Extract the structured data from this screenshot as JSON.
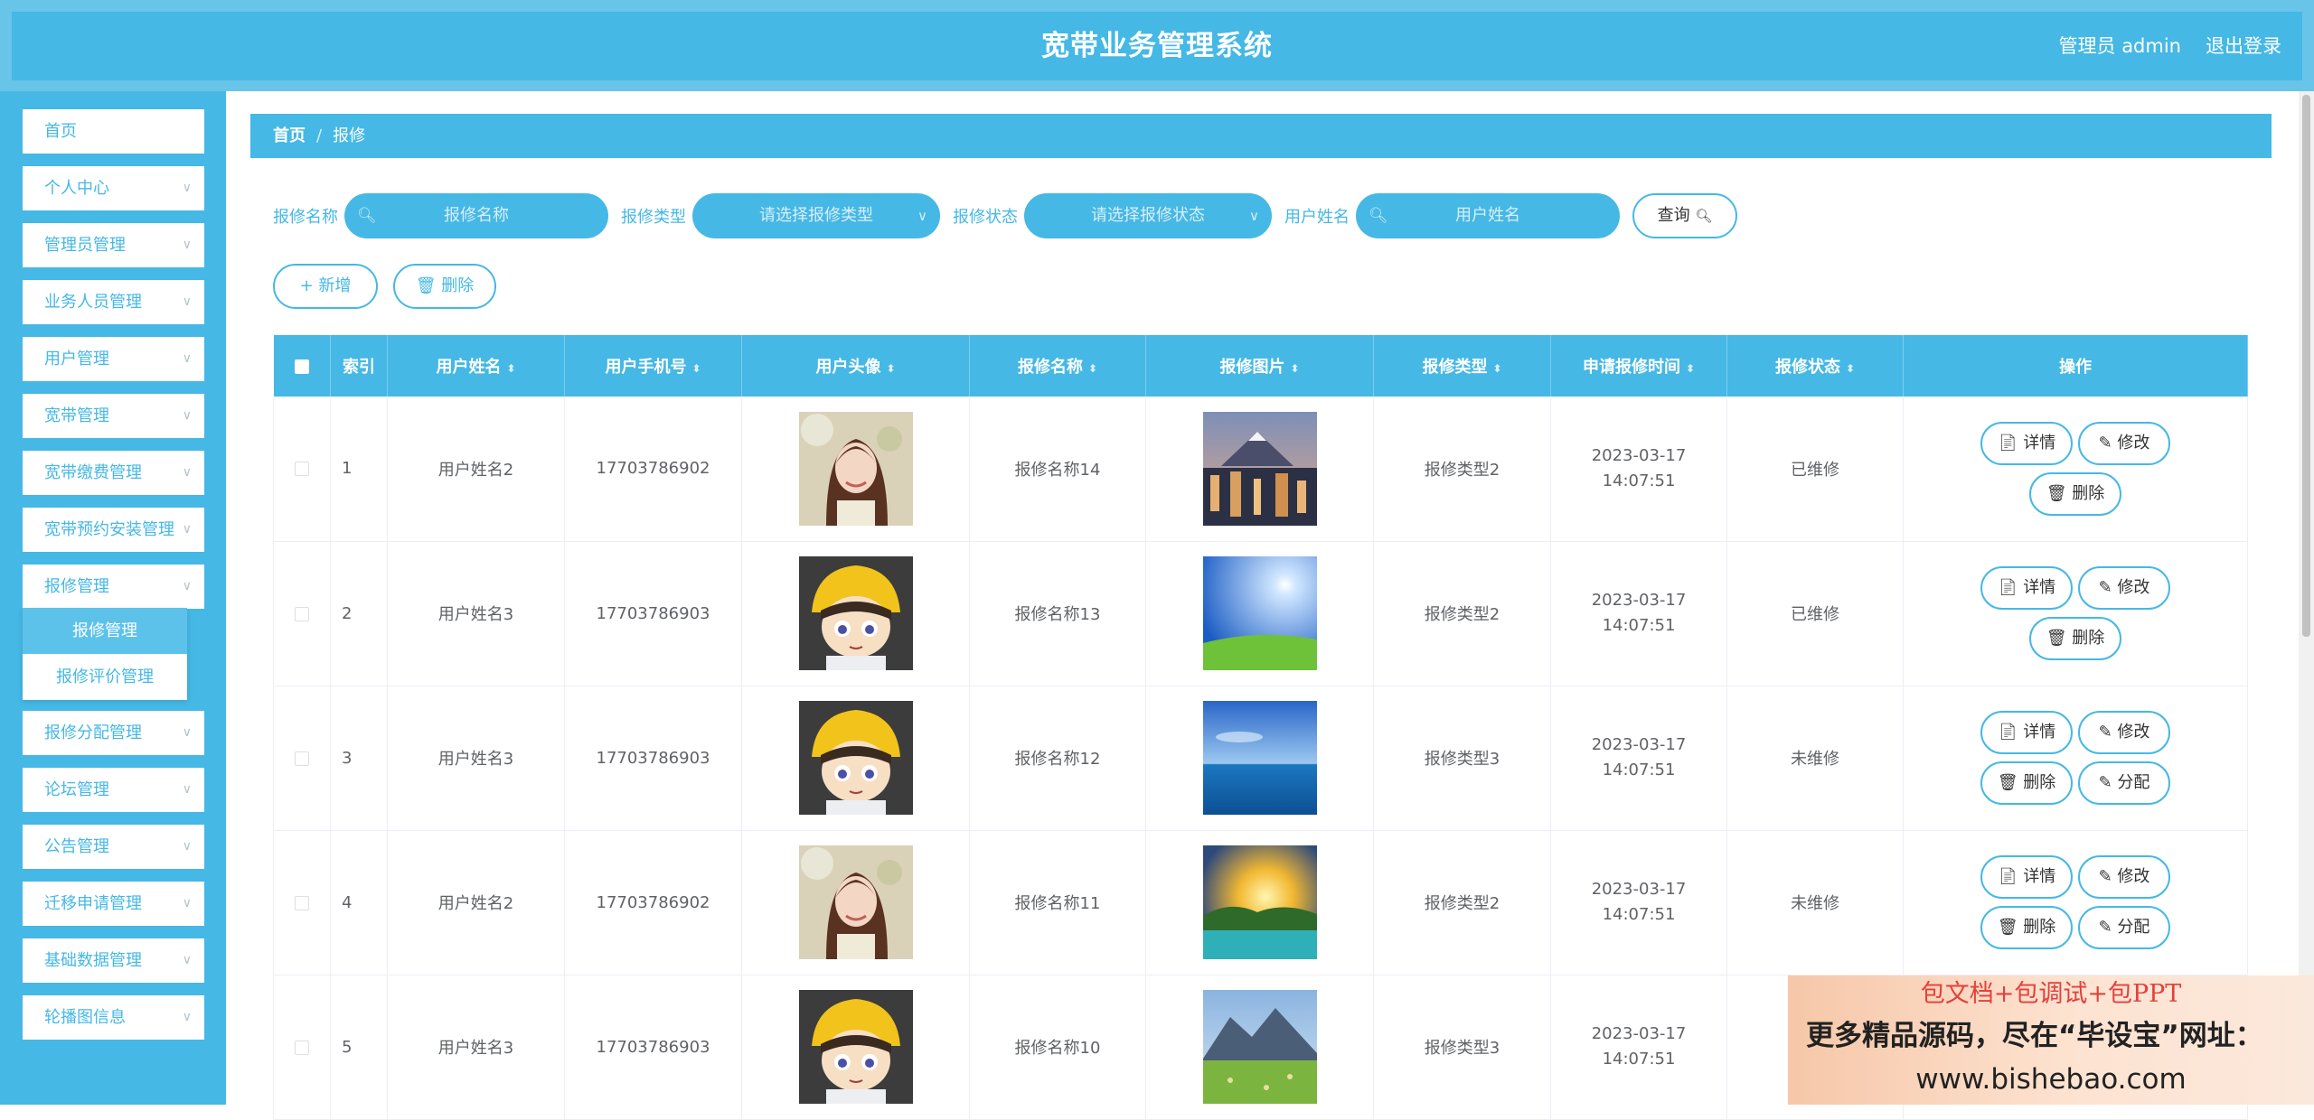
{
  "header": {
    "title": "宽带业务管理系统",
    "admin": "管理员 admin",
    "logout": "退出登录"
  },
  "sidebar": {
    "items": [
      {
        "label": "首页",
        "chevron": false
      },
      {
        "label": "个人中心",
        "chevron": true
      },
      {
        "label": "管理员管理",
        "chevron": true
      },
      {
        "label": "业务人员管理",
        "chevron": true
      },
      {
        "label": "用户管理",
        "chevron": true
      },
      {
        "label": "宽带管理",
        "chevron": true
      },
      {
        "label": "宽带缴费管理",
        "chevron": true
      },
      {
        "label": "宽带预约安装管理",
        "chevron": true
      },
      {
        "label": "报修管理",
        "chevron": true
      },
      {
        "label": "报修分配管理",
        "chevron": true
      },
      {
        "label": "论坛管理",
        "chevron": true
      },
      {
        "label": "公告管理",
        "chevron": true
      },
      {
        "label": "迁移申请管理",
        "chevron": true
      },
      {
        "label": "基础数据管理",
        "chevron": true
      },
      {
        "label": "轮播图信息",
        "chevron": true
      }
    ],
    "submenu": [
      "报修管理",
      "报修评价管理"
    ]
  },
  "breadcrumb": {
    "home": "首页",
    "current": "报修",
    "sep": "/"
  },
  "filters": {
    "name_label": "报修名称",
    "name_placeholder": "报修名称",
    "type_label": "报修类型",
    "type_placeholder": "请选择报修类型",
    "status_label": "报修状态",
    "status_placeholder": "请选择报修状态",
    "user_label": "用户姓名",
    "user_placeholder": "用户姓名",
    "query": "查询"
  },
  "actions": {
    "add": "新增",
    "delete": "删除"
  },
  "table": {
    "columns": [
      "索引",
      "用户姓名",
      "用户手机号",
      "用户头像",
      "报修名称",
      "报修图片",
      "报修类型",
      "申请报修时间",
      "报修状态",
      "操作"
    ],
    "rows": [
      {
        "index": "1",
        "user": "用户姓名2",
        "phone": "17703786902",
        "avatar": "girl-avatar",
        "name": "报修名称14",
        "pic": "city-mountain",
        "type": "报修类型2",
        "time": "2023-03-17 14:07:51",
        "status": "已维修",
        "assign": false
      },
      {
        "index": "2",
        "user": "用户姓名3",
        "phone": "17703786903",
        "avatar": "cartoon-avatar",
        "name": "报修名称13",
        "pic": "sky-grass",
        "type": "报修类型2",
        "time": "2023-03-17 14:07:51",
        "status": "已维修",
        "assign": false
      },
      {
        "index": "3",
        "user": "用户姓名3",
        "phone": "17703786903",
        "avatar": "cartoon-avatar",
        "name": "报修名称12",
        "pic": "sea-sky",
        "type": "报修类型3",
        "time": "2023-03-17 14:07:51",
        "status": "未维修",
        "assign": true
      },
      {
        "index": "4",
        "user": "用户姓名2",
        "phone": "17703786902",
        "avatar": "girl-avatar",
        "name": "报修名称11",
        "pic": "sunset-lake",
        "type": "报修类型2",
        "time": "2023-03-17 14:07:51",
        "status": "未维修",
        "assign": true
      },
      {
        "index": "5",
        "user": "用户姓名3",
        "phone": "17703786903",
        "avatar": "cartoon-avatar",
        "name": "报修名称10",
        "pic": "mountain-meadow",
        "type": "报修类型3",
        "time": "2023-03-17 14:07:51",
        "status": "",
        "assign": false
      }
    ],
    "ops": {
      "detail": "详情",
      "edit": "修改",
      "delete": "删除",
      "assign": "分配"
    }
  },
  "promo": {
    "line1": "包文档+包调试+包PPT",
    "line2": "更多精品源码，尽在“毕设宝”网址：",
    "line3": "www.bishebao.com"
  },
  "colors": {
    "primary": "#45b8e5",
    "header_outer": "#68c4e8"
  }
}
